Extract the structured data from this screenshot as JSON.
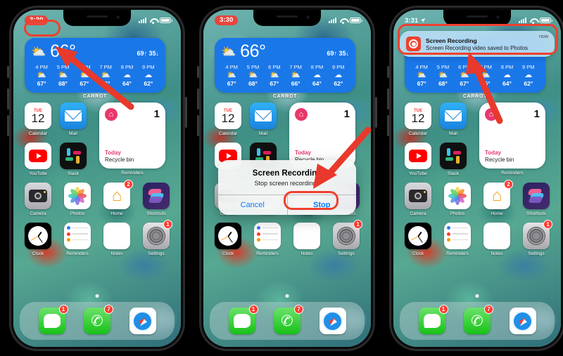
{
  "background_color": "#000000",
  "accent_red": "#f0402e",
  "phones": [
    {
      "id": "phone-1",
      "status": {
        "time": "3:30",
        "recording_pill": true,
        "location_arrow": false
      },
      "annotation": {
        "highlight": "time-indicator",
        "arrow": "points-to-time"
      }
    },
    {
      "id": "phone-2",
      "status": {
        "time": "3:30",
        "recording_pill": true,
        "location_arrow": false
      },
      "dialog": {
        "title": "Screen Recording",
        "message": "Stop screen recording?",
        "cancel_label": "Cancel",
        "stop_label": "Stop"
      },
      "annotation": {
        "highlight": "stop-button",
        "arrow": "points-to-stop"
      }
    },
    {
      "id": "phone-3",
      "status": {
        "time": "3:31",
        "recording_pill": false,
        "location_arrow": true
      },
      "notification": {
        "app_icon": "screen-recording-icon",
        "title": "Screen Recording",
        "subtitle": "Screen Recording video saved to Photos",
        "time": "now"
      },
      "annotation": {
        "highlight": "notification-banner",
        "arrow": "points-to-notification"
      }
    }
  ],
  "home_screen": {
    "weather_widget": {
      "condition_icon": "partly-cloudy-sun-icon",
      "current_temp": "66°",
      "high": "69↑",
      "low": "35↓",
      "hourly": [
        {
          "hour": "4 PM",
          "icon": "partly-cloudy-icon",
          "temp": "67°"
        },
        {
          "hour": "5 PM",
          "icon": "partly-cloudy-icon",
          "temp": "68°"
        },
        {
          "hour": "6 PM",
          "icon": "partly-cloudy-icon",
          "temp": "67°"
        },
        {
          "hour": "7 PM",
          "icon": "partly-cloudy-icon",
          "temp": "66°"
        },
        {
          "hour": "8 PM",
          "icon": "cloudy-icon",
          "temp": "64°"
        },
        {
          "hour": "9 PM",
          "icon": "cloudy-night-icon",
          "temp": "62°"
        }
      ],
      "widget_name": "CARROT"
    },
    "reminders_widget": {
      "icon": "house-reminder-icon",
      "count": "1",
      "list_name": "Today",
      "item": "Recycle bin",
      "label": "Reminders"
    },
    "apps_row1": [
      {
        "name": "Calendar",
        "icon": "calendar-icon",
        "day_name": "TUE",
        "day_num": "12",
        "badge": ""
      },
      {
        "name": "Mail",
        "icon": "mail-icon",
        "badge": ""
      }
    ],
    "apps_row2": [
      {
        "name": "YouTube",
        "icon": "youtube-icon",
        "badge": ""
      },
      {
        "name": "Slack",
        "icon": "slack-icon",
        "badge": ""
      }
    ],
    "apps_row3": [
      {
        "name": "Camera",
        "icon": "camera-icon",
        "badge": ""
      },
      {
        "name": "Photos",
        "icon": "photos-icon",
        "badge": ""
      },
      {
        "name": "Home",
        "icon": "home-icon",
        "badge": "2"
      },
      {
        "name": "Shortcuts",
        "icon": "shortcuts-icon",
        "badge": ""
      }
    ],
    "apps_row4": [
      {
        "name": "Clock",
        "icon": "clock-icon",
        "badge": ""
      },
      {
        "name": "Reminders",
        "icon": "reminders-icon",
        "badge": ""
      },
      {
        "name": "Notes",
        "icon": "notes-icon",
        "badge": ""
      },
      {
        "name": "Settings",
        "icon": "settings-icon",
        "badge": "1"
      }
    ],
    "dock": [
      {
        "name": "Messages",
        "icon": "messages-icon",
        "badge": "1"
      },
      {
        "name": "Phone",
        "icon": "phone-icon",
        "badge": "7"
      },
      {
        "name": "Safari",
        "icon": "safari-icon",
        "badge": ""
      }
    ]
  }
}
